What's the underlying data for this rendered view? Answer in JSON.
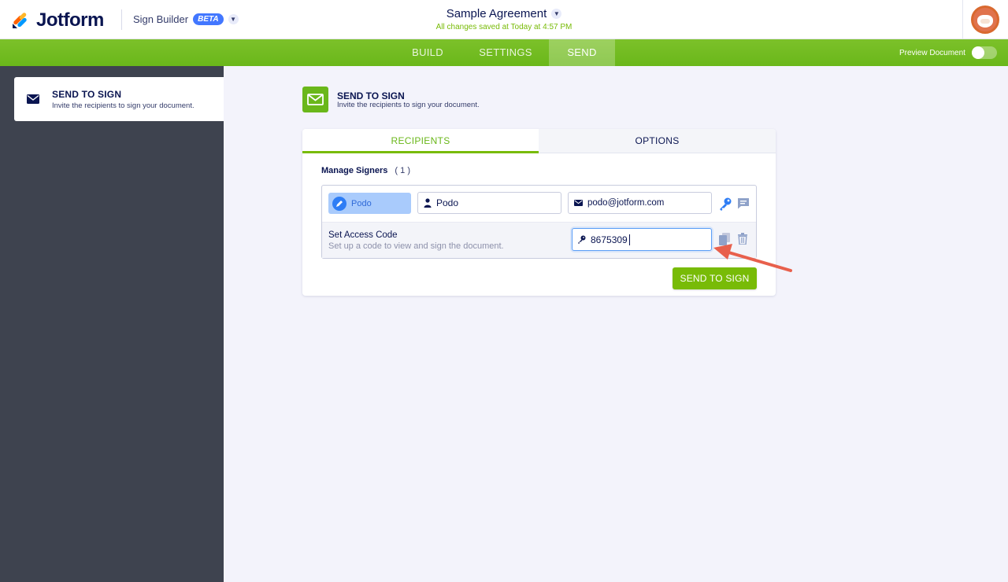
{
  "header": {
    "brand": "Jotform",
    "product": "Sign Builder",
    "badge": "BETA",
    "document_title": "Sample Agreement",
    "save_status": "All changes saved at Today at 4:57 PM"
  },
  "nav": {
    "tabs": [
      {
        "label": "BUILD",
        "active": false
      },
      {
        "label": "SETTINGS",
        "active": false
      },
      {
        "label": "SEND",
        "active": true
      }
    ],
    "preview_label": "Preview Document",
    "preview_enabled": false
  },
  "sidebar": {
    "item": {
      "title": "SEND TO SIGN",
      "description": "Invite the recipients to sign your document."
    }
  },
  "main": {
    "section_title": "SEND TO SIGN",
    "section_description": "Invite the recipients to sign your document.",
    "tabs": [
      {
        "label": "RECIPIENTS",
        "active": true
      },
      {
        "label": "OPTIONS",
        "active": false
      }
    ],
    "manage_label": "Manage Signers",
    "signer_count": "( 1 )",
    "signer": {
      "chip_label": "Podo",
      "name_value": "Podo",
      "email_value": "podo@jotform.com"
    },
    "access_code": {
      "title": "Set Access Code",
      "description": "Set up a code to view and sign the document.",
      "value": "8675309"
    },
    "send_button": "SEND TO SIGN"
  },
  "colors": {
    "accent_green": "#78bb07",
    "sidebar_bg": "#3e434f",
    "chip_blue": "#a9cbfc",
    "annotation_arrow": "#e8604c"
  }
}
